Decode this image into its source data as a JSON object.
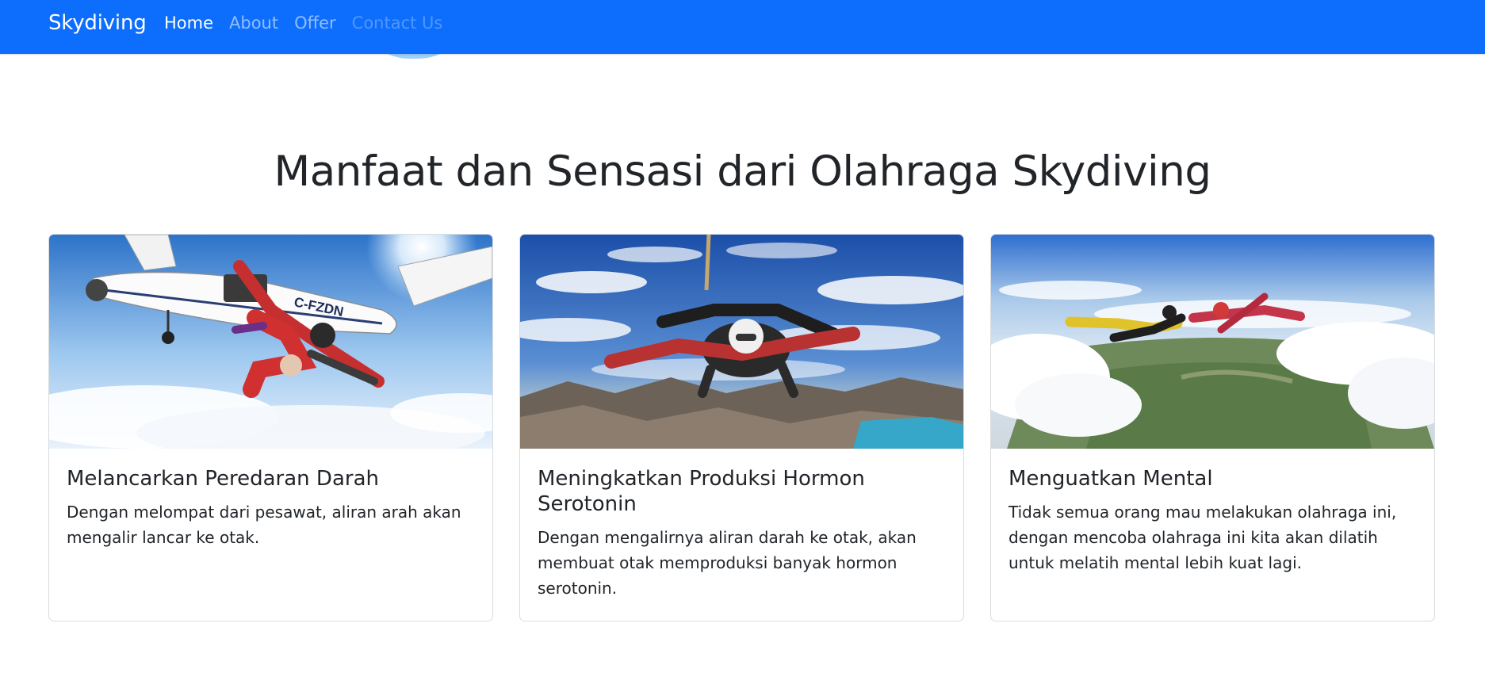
{
  "navbar": {
    "brand": "Skydiving",
    "links": [
      {
        "label": "Home",
        "state": "active"
      },
      {
        "label": "About",
        "state": "normal"
      },
      {
        "label": "Offer",
        "state": "normal"
      },
      {
        "label": "Contact Us",
        "state": "muted"
      }
    ],
    "background_color": "#0d6efd"
  },
  "section": {
    "title": "Manfaat dan Sensasi dari Olahraga Skydiving"
  },
  "cards": [
    {
      "title": "Melancarkan Peredaran Darah",
      "text": "Dengan melompat dari pesawat, aliran arah akan mengalir lancar ke otak.",
      "image": "skydivers-leaving-plane-photo",
      "plane_label": "C-FZDN"
    },
    {
      "title": "Meningkatkan Produksi Hormon Serotonin",
      "text": "Dengan mengalirnya aliran darah ke otak, akan membuat otak memproduksi banyak hormon serotonin.",
      "image": "tandem-skydivers-over-mountains-photo"
    },
    {
      "title": "Menguatkan Mental",
      "text": "Tidak semua orang mau melakukan olahraga ini, dengan mencoba olahraga ini kita akan dilatih untuk melatih mental lebih kuat lagi.",
      "image": "two-skydivers-above-clouds-photo"
    }
  ]
}
